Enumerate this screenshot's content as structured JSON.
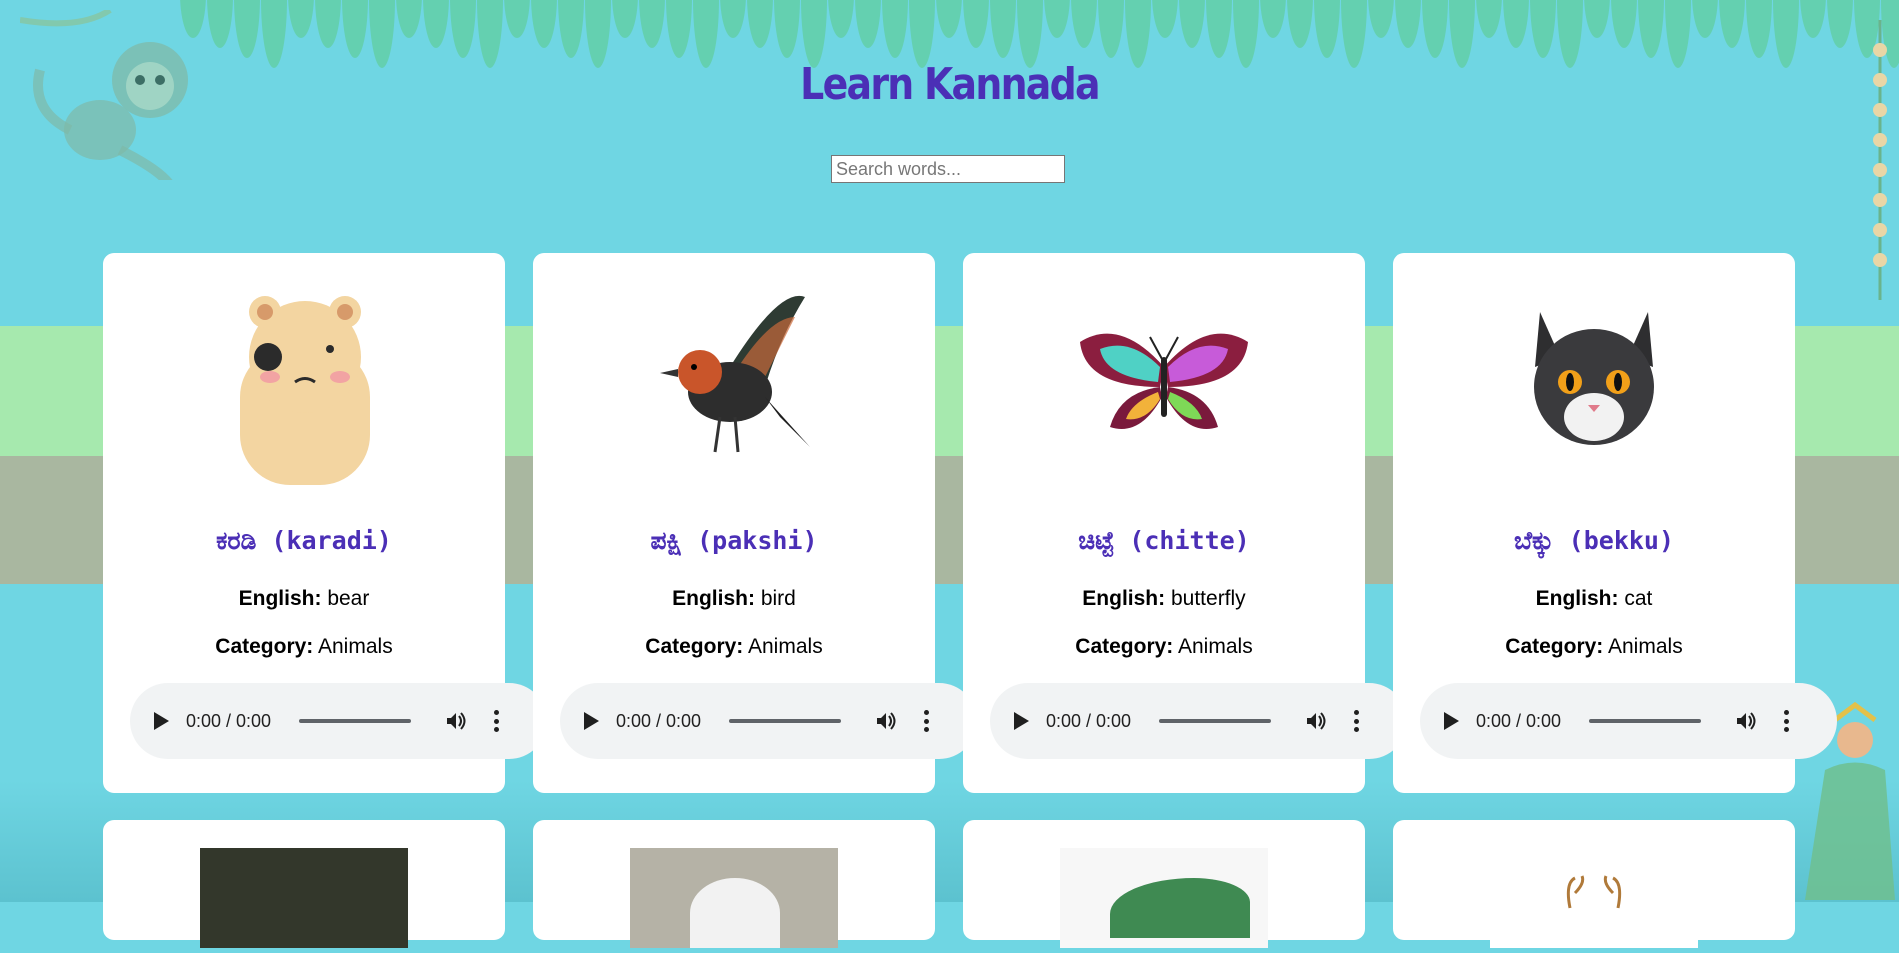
{
  "page": {
    "title": "Learn Kannada"
  },
  "search": {
    "placeholder": "Search words..."
  },
  "labels": {
    "english": "English:",
    "category": "Category:"
  },
  "cards": [
    {
      "kannada": "ಕರಡಿ (karadi)",
      "english": "bear",
      "category": "Animals",
      "time": "0:00 / 0:00",
      "image": "bear-image"
    },
    {
      "kannada": "ಪಕ್ಷಿ (pakshi)",
      "english": "bird",
      "category": "Animals",
      "time": "0:00 / 0:00",
      "image": "bird-image"
    },
    {
      "kannada": "ಚಿಟ್ಟೆ (chitte)",
      "english": "butterfly",
      "category": "Animals",
      "time": "0:00 / 0:00",
      "image": "butterfly-image"
    },
    {
      "kannada": "ಬೆಕ್ಕು (bekku)",
      "english": "cat",
      "category": "Animals",
      "time": "0:00 / 0:00",
      "image": "cat-image"
    }
  ],
  "colors": {
    "background": "#6fd6e3",
    "title": "#4b2fb6",
    "card": "#ffffff",
    "player": "#f1f3f4"
  }
}
